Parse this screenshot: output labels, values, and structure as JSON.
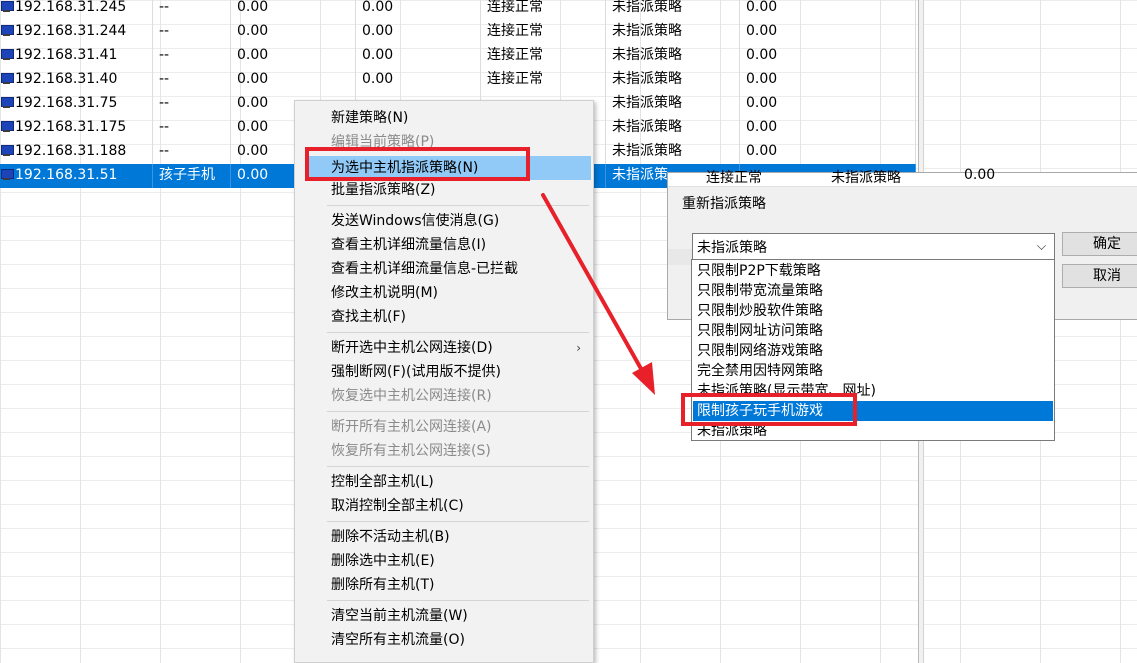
{
  "table": {
    "rows": [
      {
        "ip": "192.168.31.245",
        "name": "--",
        "v1": "0.00",
        "v2": "0.00",
        "status": "连接正常",
        "policy": "未指派策略",
        "v3": "0.00",
        "selected": false
      },
      {
        "ip": "192.168.31.244",
        "name": "--",
        "v1": "0.00",
        "v2": "0.00",
        "status": "连接正常",
        "policy": "未指派策略",
        "v3": "0.00",
        "selected": false
      },
      {
        "ip": "192.168.31.41",
        "name": "--",
        "v1": "0.00",
        "v2": "0.00",
        "status": "连接正常",
        "policy": "未指派策略",
        "v3": "0.00",
        "selected": false
      },
      {
        "ip": "192.168.31.40",
        "name": "--",
        "v1": "0.00",
        "v2": "0.00",
        "status": "连接正常",
        "policy": "未指派策略",
        "v3": "0.00",
        "selected": false
      },
      {
        "ip": "192.168.31.75",
        "name": "--",
        "v1": "0.00",
        "v2": "",
        "status": "",
        "policy": "未指派策略",
        "v3": "0.00",
        "selected": false
      },
      {
        "ip": "192.168.31.175",
        "name": "--",
        "v1": "0.00",
        "v2": "",
        "status": "",
        "policy": "未指派策略",
        "v3": "0.00",
        "selected": false
      },
      {
        "ip": "192.168.31.188",
        "name": "--",
        "v1": "0.00",
        "v2": "",
        "status": "",
        "policy": "未指派策略",
        "v3": "0.00",
        "selected": false
      },
      {
        "ip": "192.168.31.51",
        "name": "孩子手机",
        "v1": "0.00",
        "v2": "",
        "status": "",
        "policy": "未指派策",
        "v3": "",
        "selected": true
      }
    ]
  },
  "context_menu": {
    "groups": [
      [
        {
          "label": "新建策略(N)",
          "disabled": false,
          "highlighted": false
        },
        {
          "label": "编辑当前策略(P)",
          "disabled": true,
          "highlighted": false
        },
        {
          "label": "为选中主机指派策略(N)",
          "disabled": false,
          "highlighted": true
        },
        {
          "label": "批量指派策略(Z)",
          "disabled": false,
          "highlighted": false
        }
      ],
      [
        {
          "label": "发送Windows信使消息(G)",
          "disabled": false,
          "highlighted": false
        },
        {
          "label": "查看主机详细流量信息(I)",
          "disabled": false,
          "highlighted": false
        },
        {
          "label": "查看主机详细流量信息-已拦截",
          "disabled": false,
          "highlighted": false
        },
        {
          "label": "修改主机说明(M)",
          "disabled": false,
          "highlighted": false
        },
        {
          "label": "查找主机(F)",
          "disabled": false,
          "highlighted": false
        }
      ],
      [
        {
          "label": "断开选中主机公网连接(D)",
          "disabled": false,
          "highlighted": false,
          "submenu": true
        },
        {
          "label": "强制断网(F)(试用版不提供)",
          "disabled": false,
          "highlighted": false
        },
        {
          "label": "恢复选中主机公网连接(R)",
          "disabled": true,
          "highlighted": false
        }
      ],
      [
        {
          "label": "断开所有主机公网连接(A)",
          "disabled": true,
          "highlighted": false
        },
        {
          "label": "恢复所有主机公网连接(S)",
          "disabled": true,
          "highlighted": false
        }
      ],
      [
        {
          "label": "控制全部主机(L)",
          "disabled": false,
          "highlighted": false
        },
        {
          "label": "取消控制全部主机(C)",
          "disabled": false,
          "highlighted": false
        }
      ],
      [
        {
          "label": "删除不活动主机(B)",
          "disabled": false,
          "highlighted": false
        },
        {
          "label": "删除选中主机(E)",
          "disabled": false,
          "highlighted": false
        },
        {
          "label": "删除所有主机(T)",
          "disabled": false,
          "highlighted": false
        }
      ],
      [
        {
          "label": "清空当前主机流量(W)",
          "disabled": false,
          "highlighted": false
        },
        {
          "label": "清空所有主机流量(O)",
          "disabled": false,
          "highlighted": false
        }
      ]
    ]
  },
  "dialog": {
    "behind_row": {
      "status": "连接正常",
      "policy": "未指派策略",
      "v3": "0.00"
    },
    "title": "重新指派策略",
    "combo_value": "未指派策略",
    "ok_label": "确定",
    "cancel_label": "取消",
    "options": [
      {
        "label": "只限制P2P下载策略",
        "selected": false
      },
      {
        "label": "只限制带宽流量策略",
        "selected": false
      },
      {
        "label": "只限制炒股软件策略",
        "selected": false
      },
      {
        "label": "只限制网址访问策略",
        "selected": false
      },
      {
        "label": "只限制网络游戏策略",
        "selected": false
      },
      {
        "label": "完全禁用因特网策略",
        "selected": false
      },
      {
        "label": "未指派策略(显示带宽、网址)",
        "selected": false
      },
      {
        "label": "限制孩子玩手机游戏",
        "selected": true
      },
      {
        "label": "未指派策略",
        "selected": false
      }
    ]
  },
  "colors": {
    "selection": "#0078d7",
    "menu_highlight": "#91c9f7",
    "annotation_red": "#e8202a"
  }
}
